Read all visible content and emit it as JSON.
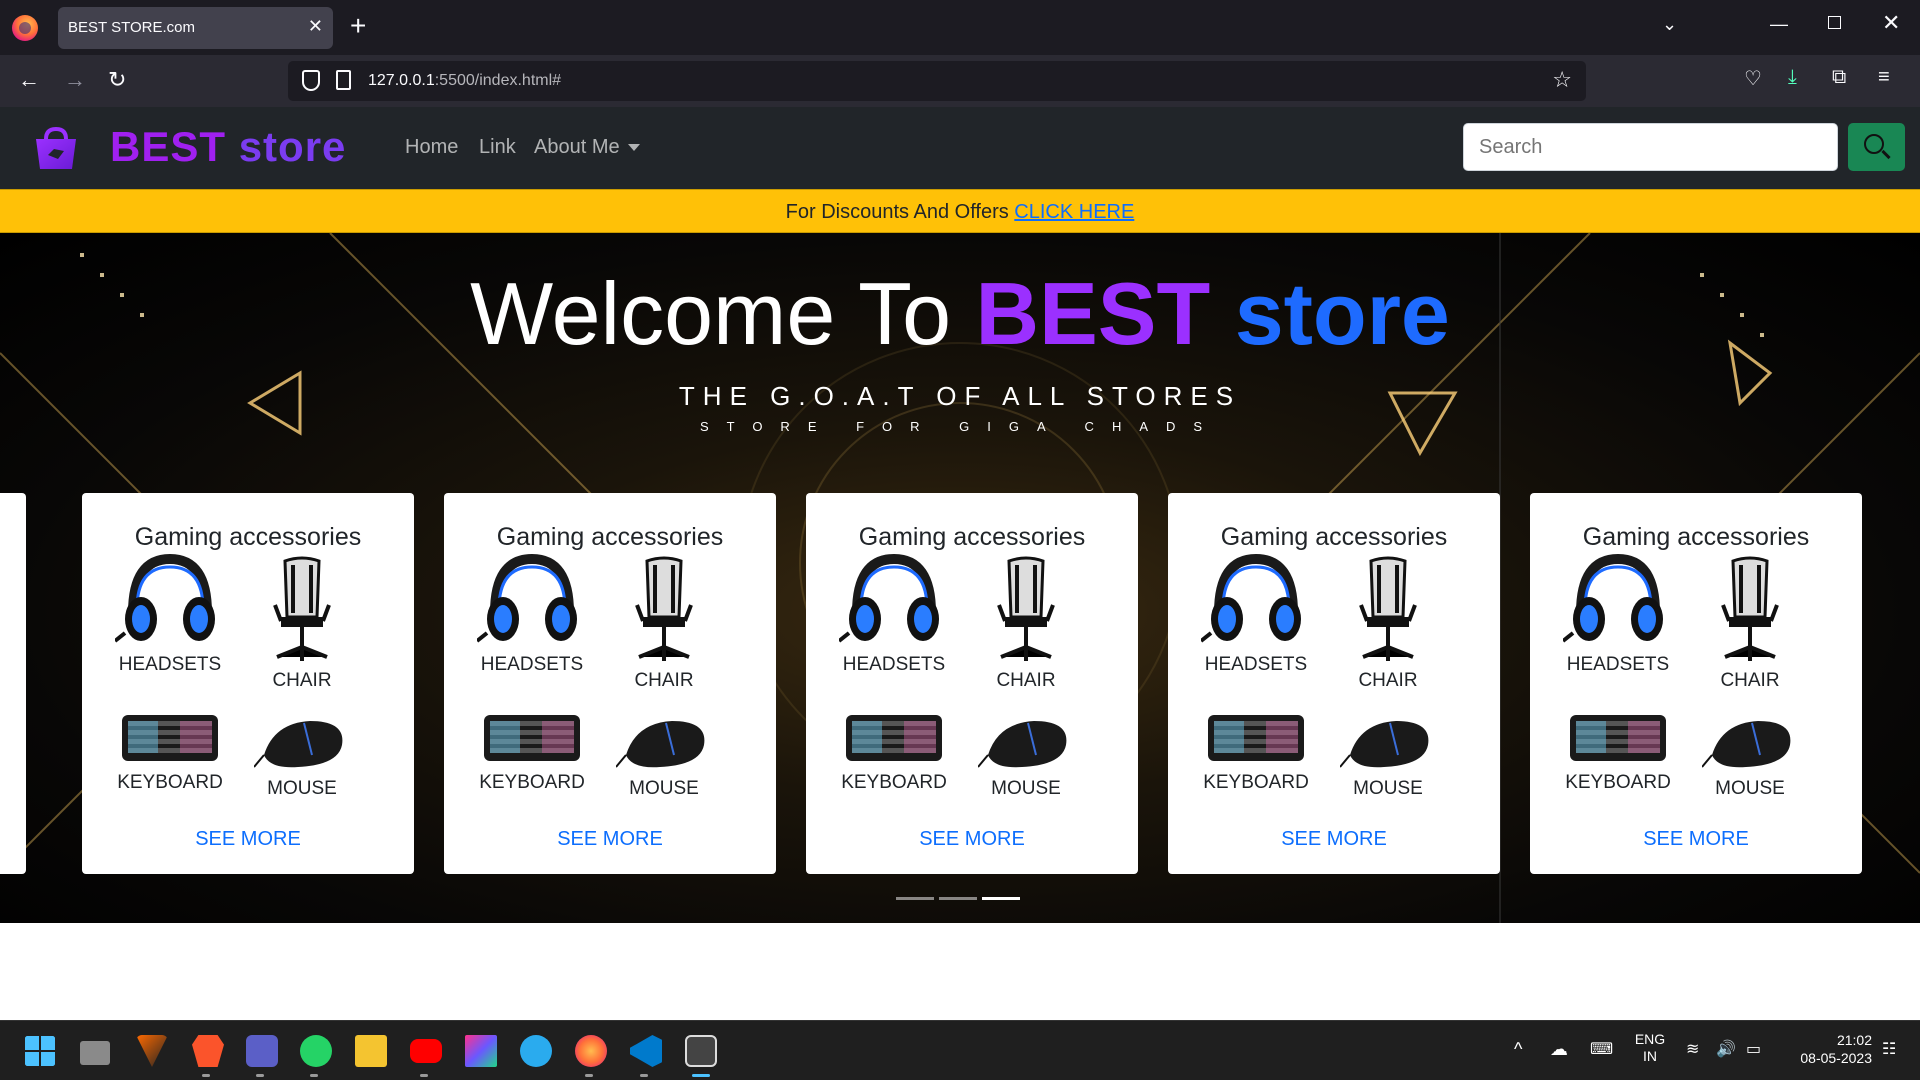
{
  "browser": {
    "tab_title": "BEST STORE.com",
    "url_host": "127.0.0.1",
    "url_rest": ":5500/index.html#",
    "new_tab_glyph": "+",
    "close_glyph": "✕"
  },
  "site": {
    "brand_part1": "BEST",
    "brand_part2": "store",
    "nav": {
      "home": "Home",
      "link": "Link",
      "about": "About Me"
    },
    "search_placeholder": "Search",
    "search_button_color": "#198754"
  },
  "banner": {
    "text": "For Discounts And Offers ",
    "link": "CLICK HERE"
  },
  "hero": {
    "welcome": "Welcome To ",
    "brand_part1": "BEST",
    "brand_part2": "store",
    "tagline": "THE G.O.A.T OF ALL STORES",
    "sub_tagline": "STORE FOR GIGA CHADS",
    "indicators_total": 3,
    "indicators_active": 3
  },
  "cards": [
    {
      "title": "Gaming accessories",
      "headsets": "HEADSETS",
      "chair": "CHAIR",
      "keyboard": "KEYBOARD",
      "mouse": "MOUSE",
      "see_more": "SEE MORE"
    },
    {
      "title": "Gaming accessories",
      "headsets": "HEADSETS",
      "chair": "CHAIR",
      "keyboard": "KEYBOARD",
      "mouse": "MOUSE",
      "see_more": "SEE MORE"
    },
    {
      "title": "Gaming accessories",
      "headsets": "HEADSETS",
      "chair": "CHAIR",
      "keyboard": "KEYBOARD",
      "mouse": "MOUSE",
      "see_more": "SEE MORE"
    },
    {
      "title": "Gaming accessories",
      "headsets": "HEADSETS",
      "chair": "CHAIR",
      "keyboard": "KEYBOARD",
      "mouse": "MOUSE",
      "see_more": "SEE MORE"
    },
    {
      "title": "Gaming accessories",
      "headsets": "HEADSETS",
      "chair": "CHAIR",
      "keyboard": "KEYBOARD",
      "mouse": "MOUSE",
      "see_more": "SEE MORE"
    }
  ],
  "taskbar": {
    "lang_line1": "ENG",
    "lang_line2": "IN",
    "time": "21:02",
    "date": "08-05-2023"
  },
  "colors": {
    "brand_purple": "#9b30ff",
    "brand_blue": "#1e6bff",
    "banner_yellow": "#ffc107",
    "navbar_dark": "#212529",
    "link_blue": "#0d6efd"
  }
}
